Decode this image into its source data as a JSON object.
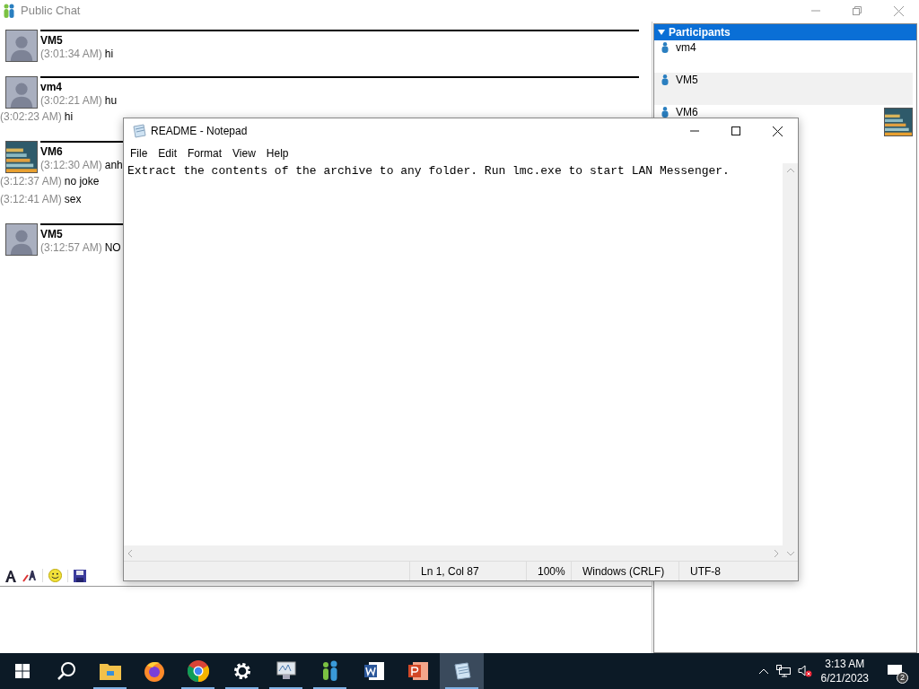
{
  "chat": {
    "title": "Public Chat",
    "messages": [
      {
        "kind": "header",
        "picture": false,
        "name": "VM5",
        "time": "(3:01:34 AM)",
        "text": "hi"
      },
      {
        "kind": "header",
        "picture": false,
        "name": "vm4",
        "time": "(3:02:21 AM)",
        "text": "hu"
      },
      {
        "kind": "line",
        "time": "(3:02:23 AM)",
        "text": "hi"
      },
      {
        "kind": "header",
        "picture": true,
        "name": "VM6",
        "time": "(3:12:30 AM)",
        "text": "anh"
      },
      {
        "kind": "line",
        "time": "(3:12:37 AM)",
        "text": "no joke"
      },
      {
        "kind": "line",
        "time": "(3:12:41 AM)",
        "text": "sex"
      },
      {
        "kind": "header",
        "picture": false,
        "name": "VM5",
        "time": "(3:12:57 AM)",
        "text": "NO"
      }
    ],
    "toolbar": [
      {
        "kind": "font"
      },
      {
        "kind": "font-color"
      },
      {
        "kind": "smiley"
      },
      {
        "kind": "save"
      }
    ],
    "participants": {
      "title": "Participants",
      "expanded": true,
      "items": [
        {
          "name": "vm4",
          "selected": false,
          "picture": false
        },
        {
          "name": "VM5",
          "selected": true,
          "picture": false
        },
        {
          "name": "VM6",
          "selected": false,
          "picture": true
        }
      ]
    }
  },
  "notepad": {
    "title": "README - Notepad",
    "menu": [
      "File",
      "Edit",
      "Format",
      "View",
      "Help"
    ],
    "content": "Extract the contents of the archive to any folder. Run lmc.exe to start LAN Messenger.",
    "status": [
      "Ln 1, Col 87",
      "100%",
      "Windows (CRLF)",
      "UTF-8"
    ]
  },
  "taskbar": {
    "apps": [
      {
        "kind": "start",
        "running": false,
        "active": false
      },
      {
        "kind": "search",
        "running": false,
        "active": false
      },
      {
        "kind": "folder",
        "running": true,
        "active": false
      },
      {
        "kind": "firefox",
        "running": false,
        "active": false
      },
      {
        "kind": "chrome",
        "running": true,
        "active": false
      },
      {
        "kind": "settings",
        "running": true,
        "active": false
      },
      {
        "kind": "monitor",
        "running": true,
        "active": false
      },
      {
        "kind": "messenger",
        "running": true,
        "active": false
      },
      {
        "kind": "word",
        "running": false,
        "active": false
      },
      {
        "kind": "powerpoint",
        "running": false,
        "active": false
      },
      {
        "kind": "notepad",
        "running": true,
        "active": true
      }
    ],
    "time": "3:13 AM",
    "date": "6/21/2023",
    "notifications": "2"
  }
}
